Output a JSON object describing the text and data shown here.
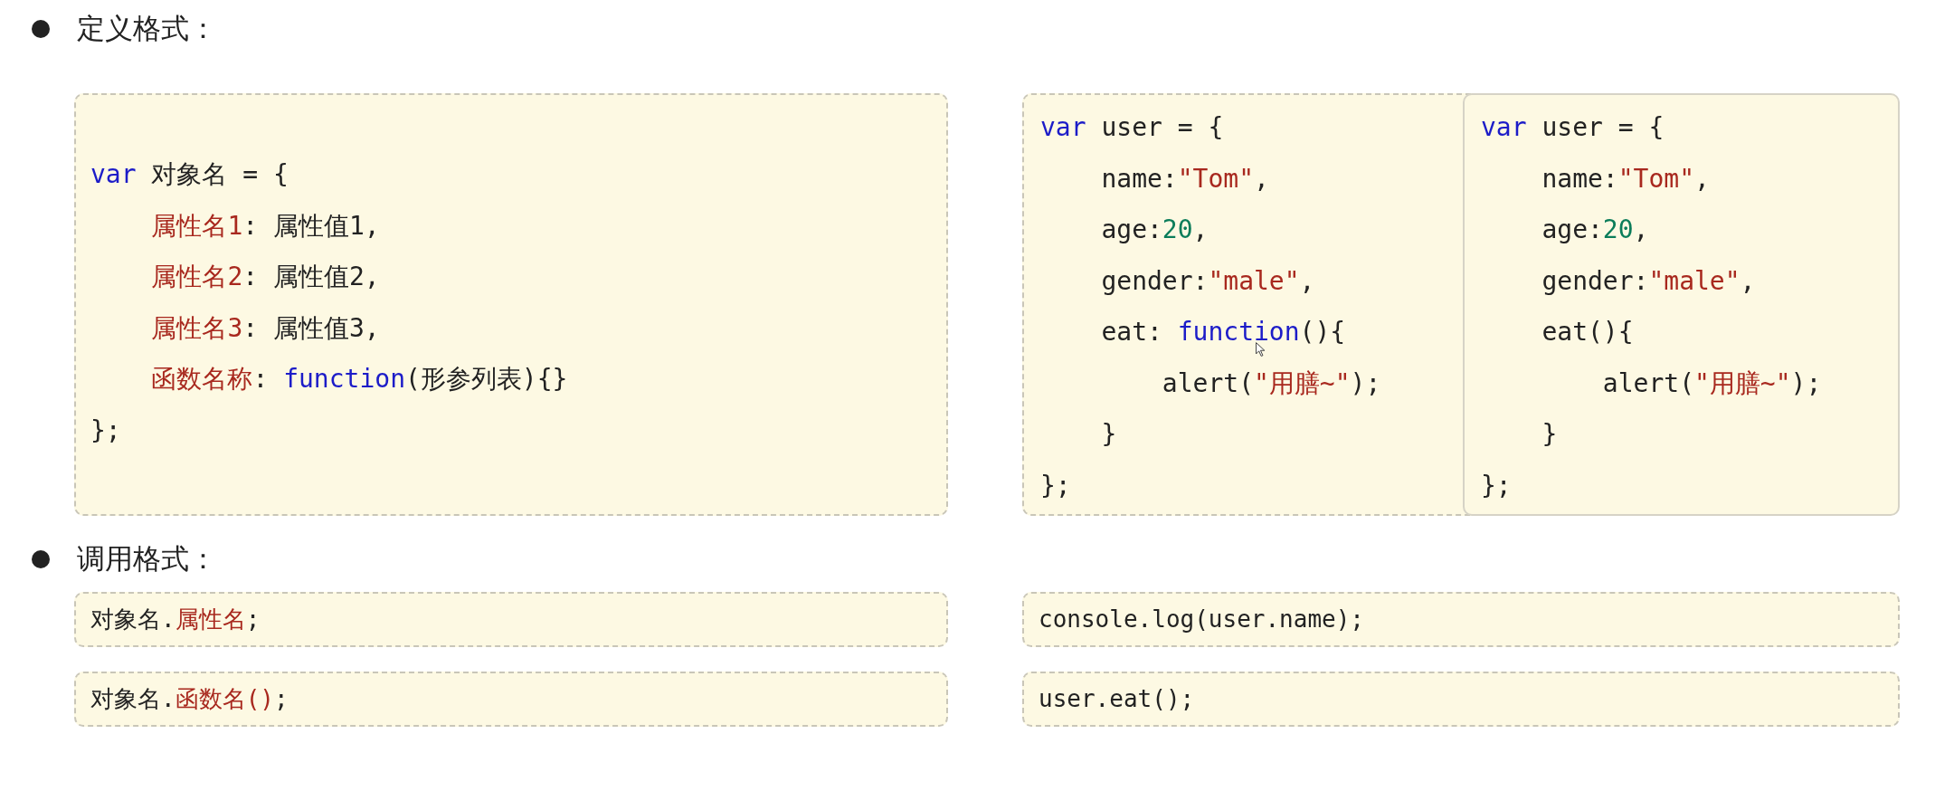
{
  "sections": [
    {
      "title": "定义格式：",
      "template": {
        "lines": [
          [
            {
              "kind": "kw",
              "text": "var"
            },
            {
              "kind": "plain",
              "text": " 对象名 = {"
            }
          ],
          [
            {
              "kind": "prop",
              "text": "    属性名1"
            },
            {
              "kind": "plain",
              "text": ": 属性值1,"
            }
          ],
          [
            {
              "kind": "prop",
              "text": "    属性名2"
            },
            {
              "kind": "plain",
              "text": ": 属性值2,"
            }
          ],
          [
            {
              "kind": "prop",
              "text": "    属性名3"
            },
            {
              "kind": "plain",
              "text": ": 属性值3,"
            }
          ],
          [
            {
              "kind": "prop",
              "text": "    函数名称"
            },
            {
              "kind": "plain",
              "text": ": "
            },
            {
              "kind": "kw",
              "text": "function"
            },
            {
              "kind": "plain",
              "text": "(形参列表){}"
            }
          ],
          [
            {
              "kind": "plain",
              "text": "};"
            }
          ]
        ]
      },
      "examples": [
        {
          "lines": [
            [
              {
                "kind": "kw",
                "text": "var"
              },
              {
                "kind": "plain",
                "text": " user = {"
              }
            ],
            [
              {
                "kind": "plain",
                "text": "    name:"
              },
              {
                "kind": "str",
                "text": "\"Tom\""
              },
              {
                "kind": "plain",
                "text": ","
              }
            ],
            [
              {
                "kind": "plain",
                "text": "    age:"
              },
              {
                "kind": "num",
                "text": "20"
              },
              {
                "kind": "plain",
                "text": ","
              }
            ],
            [
              {
                "kind": "plain",
                "text": "    gender:"
              },
              {
                "kind": "str",
                "text": "\"male\""
              },
              {
                "kind": "plain",
                "text": ","
              }
            ],
            [
              {
                "kind": "plain",
                "text": "    eat: "
              },
              {
                "kind": "kw",
                "text": "function"
              },
              {
                "kind": "plain",
                "text": "(){"
              }
            ],
            [
              {
                "kind": "plain",
                "text": "        alert("
              },
              {
                "kind": "str",
                "text": "\"用膳~\""
              },
              {
                "kind": "plain",
                "text": ");"
              }
            ],
            [
              {
                "kind": "plain",
                "text": "    }"
              }
            ],
            [
              {
                "kind": "plain",
                "text": "};"
              }
            ]
          ]
        },
        {
          "lines": [
            [
              {
                "kind": "kw",
                "text": "var"
              },
              {
                "kind": "plain",
                "text": " user = {"
              }
            ],
            [
              {
                "kind": "plain",
                "text": "    name:"
              },
              {
                "kind": "str",
                "text": "\"Tom\""
              },
              {
                "kind": "plain",
                "text": ","
              }
            ],
            [
              {
                "kind": "plain",
                "text": "    age:"
              },
              {
                "kind": "num",
                "text": "20"
              },
              {
                "kind": "plain",
                "text": ","
              }
            ],
            [
              {
                "kind": "plain",
                "text": "    gender:"
              },
              {
                "kind": "str",
                "text": "\"male\""
              },
              {
                "kind": "plain",
                "text": ","
              }
            ],
            [
              {
                "kind": "plain",
                "text": "    eat(){"
              }
            ],
            [
              {
                "kind": "plain",
                "text": "        alert("
              },
              {
                "kind": "str",
                "text": "\"用膳~\""
              },
              {
                "kind": "plain",
                "text": ");"
              }
            ],
            [
              {
                "kind": "plain",
                "text": "    }"
              }
            ],
            [
              {
                "kind": "plain",
                "text": "};"
              }
            ]
          ]
        }
      ]
    },
    {
      "title": "调用格式：",
      "rows": [
        {
          "syntax": [
            {
              "kind": "plain",
              "text": "对象名."
            },
            {
              "kind": "prop",
              "text": "属性名"
            },
            {
              "kind": "plain",
              "text": ";"
            }
          ],
          "example": [
            {
              "kind": "plain",
              "text": "console.log(user.name);"
            }
          ]
        },
        {
          "syntax": [
            {
              "kind": "plain",
              "text": "对象名."
            },
            {
              "kind": "prop",
              "text": "函数名()"
            },
            {
              "kind": "plain",
              "text": ";"
            }
          ],
          "example": [
            {
              "kind": "plain",
              "text": "user.eat();"
            }
          ]
        }
      ]
    }
  ]
}
